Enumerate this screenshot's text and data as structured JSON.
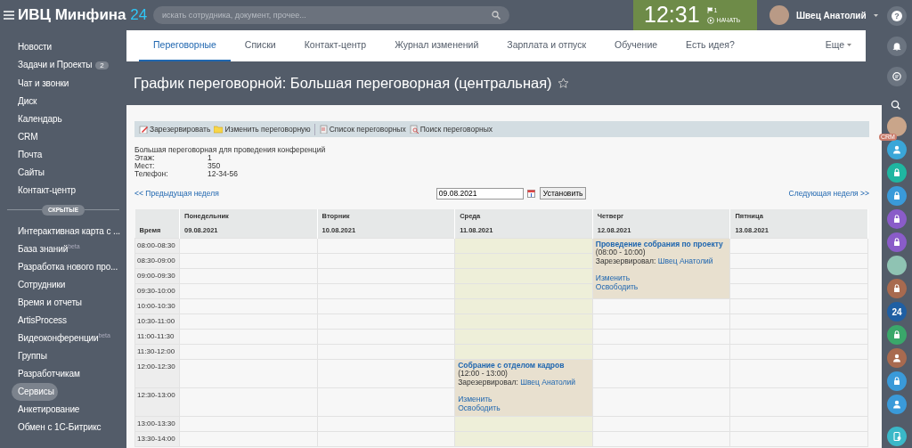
{
  "header": {
    "logo": "ИВЦ Минфина",
    "logo_accent": "24",
    "search": {
      "placeholder": "искать сотрудника, документ, прочее..."
    },
    "clock": {
      "time": "12:31",
      "flag_count": "1",
      "start": "НАЧАТЬ"
    },
    "user": {
      "name": "Швец Анатолий"
    }
  },
  "sidebar": {
    "items": [
      {
        "label": "Новости",
        "selected": false
      },
      {
        "label": "Задачи и Проекты",
        "counter": "2",
        "selected": false
      },
      {
        "label": "Чат и звонки",
        "selected": false
      },
      {
        "label": "Диск",
        "selected": false
      },
      {
        "label": "Календарь",
        "selected": false
      },
      {
        "label": "CRM",
        "selected": false
      },
      {
        "label": "Почта",
        "selected": false
      },
      {
        "label": "Сайты",
        "selected": false
      },
      {
        "label": "Контакт-центр",
        "selected": false
      }
    ],
    "hidden_label": "СКРЫТЫЕ",
    "hidden_items": [
      {
        "label": "Интерактивная карта с ...",
        "selected": false
      },
      {
        "label": "База знаний$^{beta}$",
        "selected": false
      },
      {
        "label": "Разработка нового про...",
        "selected": false
      },
      {
        "label": "Сотрудники",
        "selected": false
      },
      {
        "label": "Время и отчеты",
        "selected": false
      },
      {
        "label": "ArtisProcess",
        "selected": false
      },
      {
        "label": "Видеоконференции$^{beta}$",
        "selected": false
      },
      {
        "label": "Группы",
        "selected": false
      },
      {
        "label": "Разработчикам",
        "selected": false
      },
      {
        "label": "Сервисы",
        "selected": true
      },
      {
        "label": "Анкетирование",
        "selected": false
      },
      {
        "label": "Обмен с 1С-Битрикс",
        "selected": false
      }
    ]
  },
  "tabs": [
    {
      "label": "Переговорные",
      "selected": true
    },
    {
      "label": "Списки",
      "selected": false
    },
    {
      "label": "Контакт-центр",
      "selected": false
    },
    {
      "label": "Журнал изменений",
      "selected": false
    },
    {
      "label": "Зарплата и отпуск",
      "selected": false
    },
    {
      "label": "Обучение",
      "selected": false
    },
    {
      "label": "Есть идея?",
      "selected": false
    }
  ],
  "more": "Еще",
  "page_title": "График переговорной: Большая переговорная (центральная)",
  "toolbar": [
    {
      "kind": "reserve",
      "label": "Зарезервировать"
    },
    {
      "kind": "edit",
      "label": "Изменить переговорную"
    },
    {
      "kind": "list",
      "label": "Список переговорных"
    },
    {
      "kind": "search",
      "label": "Поиск переговорных"
    }
  ],
  "room": {
    "description": "Большая переговорная для проведения конференций",
    "fields": [
      {
        "label": "Этаж:",
        "value": "1"
      },
      {
        "label": "Мест:",
        "value": "350"
      },
      {
        "label": "Телефон:",
        "value": "12-34-56"
      }
    ]
  },
  "week_nav": {
    "prev": "<< Предыдущая неделя",
    "date": "09.08.2021",
    "set": "Установить",
    "next": "Следующая неделя >>"
  },
  "schedule": {
    "time_label": "Время",
    "days": [
      {
        "name": "Понедельник",
        "date": "09.08.2021",
        "today": false
      },
      {
        "name": "Вторник",
        "date": "10.08.2021",
        "today": false
      },
      {
        "name": "Среда",
        "date": "11.08.2021",
        "today": true
      },
      {
        "name": "Четверг",
        "date": "12.08.2021",
        "today": false
      },
      {
        "name": "Пятница",
        "date": "13.08.2021",
        "today": false
      }
    ],
    "rows": [
      {
        "time": "08:00-08:30",
        "cells": [
          {
            "kind": "free"
          },
          {
            "kind": "free"
          },
          {
            "kind": "free"
          },
          {
            "kind": "booking",
            "title": "Проведение собрания по проекту",
            "time": "(08:00 - 10:00)",
            "reserved_label": "Зарезервировал:",
            "reserved_by": "Швец Анатолий",
            "edit": "Изменить",
            "release": "Освободить"
          },
          {
            "kind": "free"
          }
        ]
      },
      {
        "time": "08:30-09:00",
        "cells": [
          {
            "kind": "free"
          },
          {
            "kind": "free"
          },
          {
            "kind": "free"
          },
          {
            "kind": "continued"
          },
          {
            "kind": "free"
          }
        ]
      },
      {
        "time": "09:00-09:30",
        "cells": [
          {
            "kind": "free"
          },
          {
            "kind": "free"
          },
          {
            "kind": "free"
          },
          {
            "kind": "continued"
          },
          {
            "kind": "free"
          }
        ]
      },
      {
        "time": "09:30-10:00",
        "cells": [
          {
            "kind": "free"
          },
          {
            "kind": "free"
          },
          {
            "kind": "free"
          },
          {
            "kind": "continued"
          },
          {
            "kind": "free"
          }
        ]
      },
      {
        "time": "10:00-10:30",
        "cells": [
          {
            "kind": "free"
          },
          {
            "kind": "free"
          },
          {
            "kind": "free"
          },
          {
            "kind": "free"
          },
          {
            "kind": "free"
          }
        ]
      },
      {
        "time": "10:30-11:00",
        "cells": [
          {
            "kind": "free"
          },
          {
            "kind": "free"
          },
          {
            "kind": "free"
          },
          {
            "kind": "free"
          },
          {
            "kind": "free"
          }
        ]
      },
      {
        "time": "11:00-11:30",
        "cells": [
          {
            "kind": "free"
          },
          {
            "kind": "free"
          },
          {
            "kind": "free"
          },
          {
            "kind": "free"
          },
          {
            "kind": "free"
          }
        ]
      },
      {
        "time": "11:30-12:00",
        "cells": [
          {
            "kind": "free"
          },
          {
            "kind": "free"
          },
          {
            "kind": "free"
          },
          {
            "kind": "free"
          },
          {
            "kind": "free"
          }
        ]
      },
      {
        "time": "12:00-12:30",
        "cells": [
          {
            "kind": "free"
          },
          {
            "kind": "free"
          },
          {
            "kind": "booking",
            "title": "Собрание с отделом кадров",
            "time": "(12:00 - 13:00)",
            "reserved_label": "Зарезервировал:",
            "reserved_by": "Швец Анатолий",
            "edit": "Изменить",
            "release": "Освободить"
          },
          {
            "kind": "free"
          },
          {
            "kind": "free"
          }
        ]
      },
      {
        "time": "12:30-13:00",
        "cells": [
          {
            "kind": "free"
          },
          {
            "kind": "free"
          },
          {
            "kind": "continued"
          },
          {
            "kind": "free"
          },
          {
            "kind": "free"
          }
        ]
      },
      {
        "time": "13:00-13:30",
        "cells": [
          {
            "kind": "free"
          },
          {
            "kind": "free"
          },
          {
            "kind": "free"
          },
          {
            "kind": "free"
          },
          {
            "kind": "free"
          }
        ]
      },
      {
        "time": "13:30-14:00",
        "cells": [
          {
            "kind": "free"
          },
          {
            "kind": "free"
          },
          {
            "kind": "free"
          },
          {
            "kind": "free"
          },
          {
            "kind": "free"
          }
        ]
      }
    ]
  },
  "right_bar": [
    {
      "kind": "help",
      "color": "#6b7480",
      "text": "?"
    },
    {
      "kind": "bell",
      "color": "#6b7480"
    },
    {
      "kind": "chat",
      "color": "#6b7480"
    },
    {
      "kind": "search"
    },
    {
      "kind": "photo",
      "color": "#c9a58a"
    },
    {
      "kind": "user",
      "color": "#3aa6d8",
      "badge": "CRM"
    },
    {
      "kind": "lock",
      "color": "#1fb6a1"
    },
    {
      "kind": "lock",
      "color": "#3a9ad9"
    },
    {
      "kind": "lock",
      "color": "#8a5cc9"
    },
    {
      "kind": "lock",
      "color": "#8a5cc9"
    },
    {
      "kind": "photo",
      "color": "#8fc3b3"
    },
    {
      "kind": "lock",
      "color": "#a86a4f"
    },
    {
      "kind": "text",
      "color": "#1f5fa3",
      "text": "24"
    },
    {
      "kind": "lock",
      "color": "#3aa76a"
    },
    {
      "kind": "user",
      "color": "#a86a4f"
    },
    {
      "kind": "lock",
      "color": "#3a9ad9"
    },
    {
      "kind": "user",
      "color": "#3a9ad9"
    },
    {
      "kind": "phone",
      "color": "#3ab8c8"
    }
  ]
}
